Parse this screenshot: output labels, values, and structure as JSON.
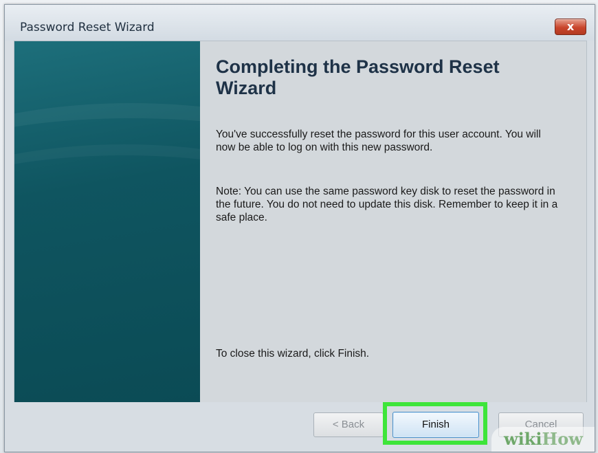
{
  "window": {
    "title": "Password Reset Wizard",
    "close_label": "x"
  },
  "main": {
    "heading": "Completing the Password Reset Wizard",
    "paragraph1": "You've successfully reset the password for this user account. You will now be able to log on with this new password.",
    "paragraph2": "Note: You can use the same password key disk to reset the password in the future. You do not need to update this disk. Remember to keep it in a safe place.",
    "paragraph3": "To close this wizard, click Finish."
  },
  "buttons": {
    "back": "< Back",
    "finish": "Finish",
    "cancel": "Cancel"
  },
  "watermark": {
    "part1": "wiki",
    "part2": "How"
  },
  "colors": {
    "highlight": "#3ee53a",
    "side_panel": "#0f5560",
    "close_button": "#c9452c"
  }
}
